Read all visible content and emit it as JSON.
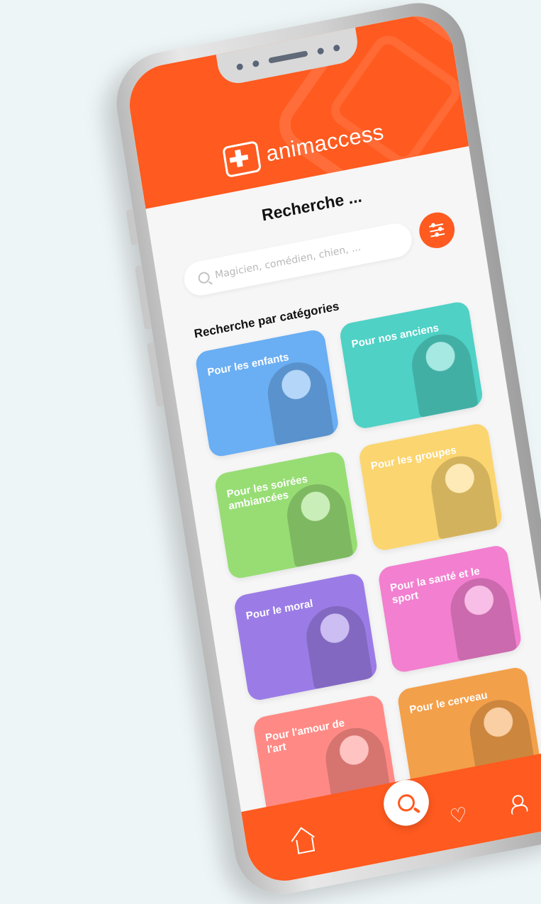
{
  "app": {
    "brand": "animaccess"
  },
  "search": {
    "title": "Recherche ...",
    "placeholder": "Magicien, comédien, chien, ..."
  },
  "categories": {
    "section_title": "Recherche par catégories",
    "items": [
      {
        "label": "Pour les enfants",
        "color": "#6aaef3"
      },
      {
        "label": "Pour nos anciens",
        "color": "#4fd1c5"
      },
      {
        "label": "Pour les soirées ambiancées",
        "color": "#97dd74"
      },
      {
        "label": "Pour les groupes",
        "color": "#fbd56f"
      },
      {
        "label": "Pour le moral",
        "color": "#9b7ce6"
      },
      {
        "label": "Pour la santé et le sport",
        "color": "#f27fcf"
      },
      {
        "label": "Pour l'amour de l'art",
        "color": "#ff8a85"
      },
      {
        "label": "Pour le cerveau",
        "color": "#f3a04a"
      }
    ]
  },
  "bottom_nav": {
    "items": [
      {
        "icon": "home-icon"
      },
      {
        "icon": "search-icon",
        "active": true
      },
      {
        "icon": "heart-icon"
      },
      {
        "icon": "user-icon"
      }
    ]
  },
  "colors": {
    "accent": "#ff5a1f",
    "background": "#f6f6f6"
  }
}
